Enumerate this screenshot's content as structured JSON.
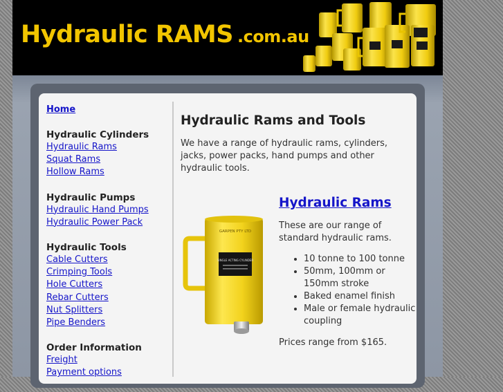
{
  "header": {
    "logo_main": "Hydraulic  RAMS",
    "logo_domain": ".com.au"
  },
  "sidebar": {
    "home": "Home",
    "groups": [
      {
        "heading": "Hydraulic Cylinders",
        "links": [
          "Hydraulic Rams",
          "Squat Rams",
          "Hollow Rams"
        ]
      },
      {
        "heading": "Hydraulic Pumps",
        "links": [
          "Hydraulic Hand Pumps",
          "Hydraulic Power Pack"
        ]
      },
      {
        "heading": "Hydraulic Tools",
        "links": [
          "Cable Cutters",
          "Crimping Tools",
          "Hole Cutters",
          "Rebar Cutters",
          "Nut Splitters",
          "Pipe Benders"
        ]
      },
      {
        "heading": "Order Information",
        "links": [
          "Freight",
          "Payment options"
        ]
      }
    ]
  },
  "main": {
    "title": "Hydraulic Rams and Tools",
    "intro": "We have a range of hydraulic rams, cylinders, jacks, power packs, hand pumps and other hydraulic tools."
  },
  "product": {
    "title": "Hydraulic Rams",
    "description": "These are our range of standard hydraulic rams.",
    "features": [
      "10 tonne to 100 tonne",
      "50mm, 100mm or 150mm stroke",
      "Baked enamel finish",
      "Male or female hydraulic coupling"
    ],
    "price": "Prices range from $165.",
    "image_label": "GARPEN PTY LTD",
    "image_sublabel": "SINGLE ACTING CYLINDER"
  },
  "colors": {
    "logo_yellow": "#f2c500",
    "link_blue": "#1515c9",
    "ram_yellow": "#f2d21c"
  }
}
